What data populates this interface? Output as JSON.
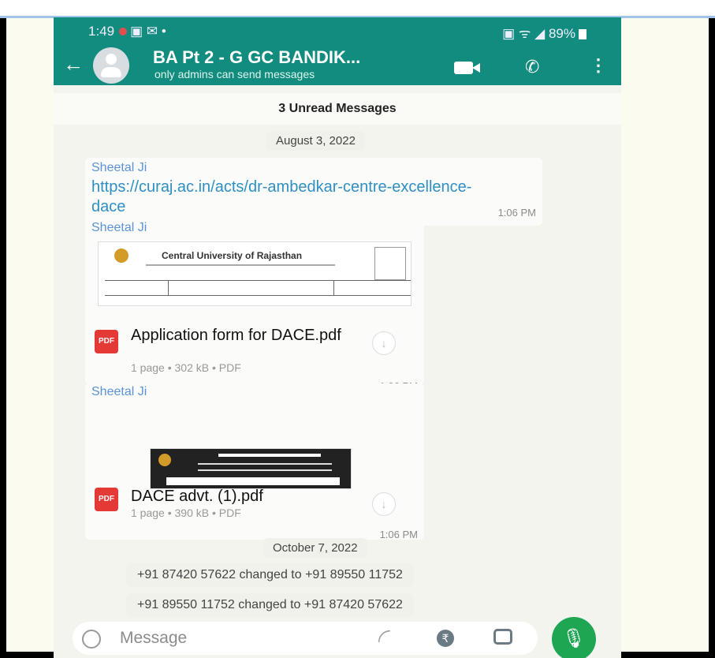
{
  "status": {
    "time": "1:49",
    "battery": "89%"
  },
  "header": {
    "title": "BA Pt 2 - G  GC BANDIK...",
    "subtitle": "only admins can send messages"
  },
  "banner": {
    "unread": "3 Unread Messages"
  },
  "messages": [
    {
      "date": "August 3, 2022"
    },
    {
      "sender": "Sheetal Ji",
      "link": "https://curaj.ac.in/acts/dr-ambedkar-centre-excellence-dace",
      "time": "1:06 PM"
    },
    {
      "sender": "Sheetal Ji",
      "file_name": "Application form for DACE.pdf",
      "file_meta": "1 page • 302 kB • PDF",
      "time": "1:06 PM",
      "thumb": "Central University of Rajasthan"
    },
    {
      "sender": "Sheetal Ji",
      "file_name": "DACE advt. (1).pdf",
      "file_meta": "1 page • 390 kB • PDF",
      "time": "1:06 PM"
    }
  ],
  "system": {
    "date": "October 7, 2022",
    "change1": "+91 87420 57622 changed to +91 89550 11752",
    "change2": "+91 89550 11752 changed to +91 87420 57622"
  },
  "composer": {
    "placeholder": "Message"
  },
  "icons": {
    "emoji": "emoji-icon",
    "attach": "paperclip-icon",
    "payment": "rupee-icon",
    "camera": "camera-icon",
    "mic": "mic-icon"
  },
  "colors": {
    "header": "#128c7e",
    "mic": "#1fa652",
    "link": "#2f8fc2",
    "sender": "#5b93d8"
  }
}
